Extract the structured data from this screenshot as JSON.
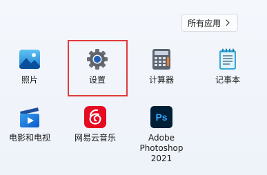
{
  "header": {
    "all_apps_label": "所有应用"
  },
  "apps": [
    {
      "label": "照片",
      "icon": "photos-icon"
    },
    {
      "label": "设置",
      "icon": "settings-gear-icon"
    },
    {
      "label": "计算器",
      "icon": "calculator-icon"
    },
    {
      "label": "记事本",
      "icon": "notepad-icon"
    },
    {
      "label": "电影和电视",
      "icon": "movies-tv-icon"
    },
    {
      "label": "网易云音乐",
      "icon": "netease-music-icon"
    },
    {
      "label_line1": "Adobe",
      "label_line2": "Photoshop 2021",
      "icon": "photoshop-icon",
      "icon_text": "Ps"
    }
  ],
  "highlight": {
    "target": "设置",
    "color": "#e03a3a"
  }
}
